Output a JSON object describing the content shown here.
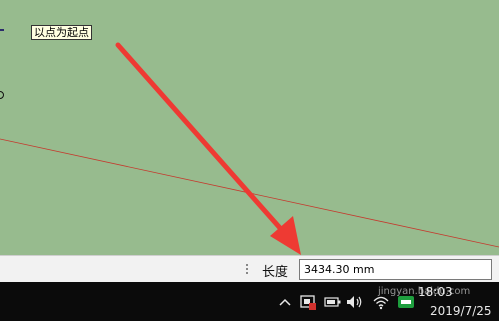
{
  "canvas": {
    "background": "#97bb8e",
    "tooltip": "以点为起点",
    "line_color": "#c43a2e"
  },
  "statusbar": {
    "measure_label": "长度",
    "measure_value": "3434.30 mm"
  },
  "taskbar": {
    "time": "18:03",
    "date": "2019/7/25",
    "icons": [
      "chevron-up-icon",
      "app-alert-icon",
      "battery-icon",
      "volume-icon",
      "network-icon",
      "ime-icon"
    ]
  },
  "annotation": {
    "arrow_color": "#ee3a33"
  },
  "watermark": {
    "text": "jingyan.baidu.com"
  }
}
